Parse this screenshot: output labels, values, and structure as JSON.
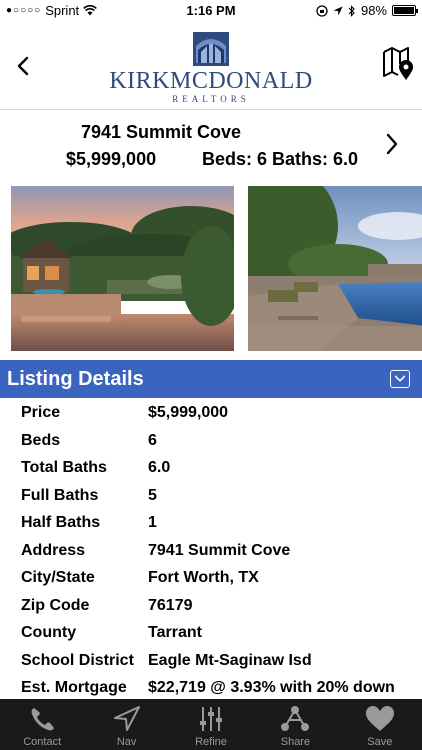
{
  "status_bar": {
    "signal_dots": "●○○○○",
    "carrier": "Sprint",
    "time": "1:16 PM",
    "battery_percent": "98%",
    "battery_level": 0.98
  },
  "header": {
    "logo_name": "KIRKMCDONALD",
    "logo_subtitle": "REALTORS"
  },
  "summary": {
    "address": "7941 Summit Cove",
    "price": "$5,999,000",
    "beds_baths": "Beds: 6  Baths: 6.0"
  },
  "details_header": {
    "title": "Listing Details"
  },
  "details": [
    {
      "label": "Price",
      "value": "$5,999,000"
    },
    {
      "label": "Beds",
      "value": "6"
    },
    {
      "label": "Total Baths",
      "value": "6.0"
    },
    {
      "label": "Full Baths",
      "value": "5"
    },
    {
      "label": "Half Baths",
      "value": "1"
    },
    {
      "label": "Address",
      "value": "7941 Summit Cove"
    },
    {
      "label": "City/State",
      "value": "Fort Worth, TX"
    },
    {
      "label": "Zip Code",
      "value": "76179"
    },
    {
      "label": "County",
      "value": "Tarrant"
    },
    {
      "label": "School District",
      "value": "Eagle Mt-Saginaw Isd"
    },
    {
      "label": "Est. Mortgage",
      "value": "$22,719 @ 3.93% with 20% down"
    }
  ],
  "tabs": [
    {
      "label": "Contact",
      "icon": "phone-icon"
    },
    {
      "label": "Nav",
      "icon": "navigation-arrow-icon"
    },
    {
      "label": "Refine",
      "icon": "sliders-icon"
    },
    {
      "label": "Share",
      "icon": "share-icon"
    },
    {
      "label": "Save",
      "icon": "heart-icon"
    }
  ],
  "colors": {
    "accent_bar": "#3a64c0",
    "brand": "#2f4a7c",
    "tab_bar": "#1a1a1a"
  }
}
